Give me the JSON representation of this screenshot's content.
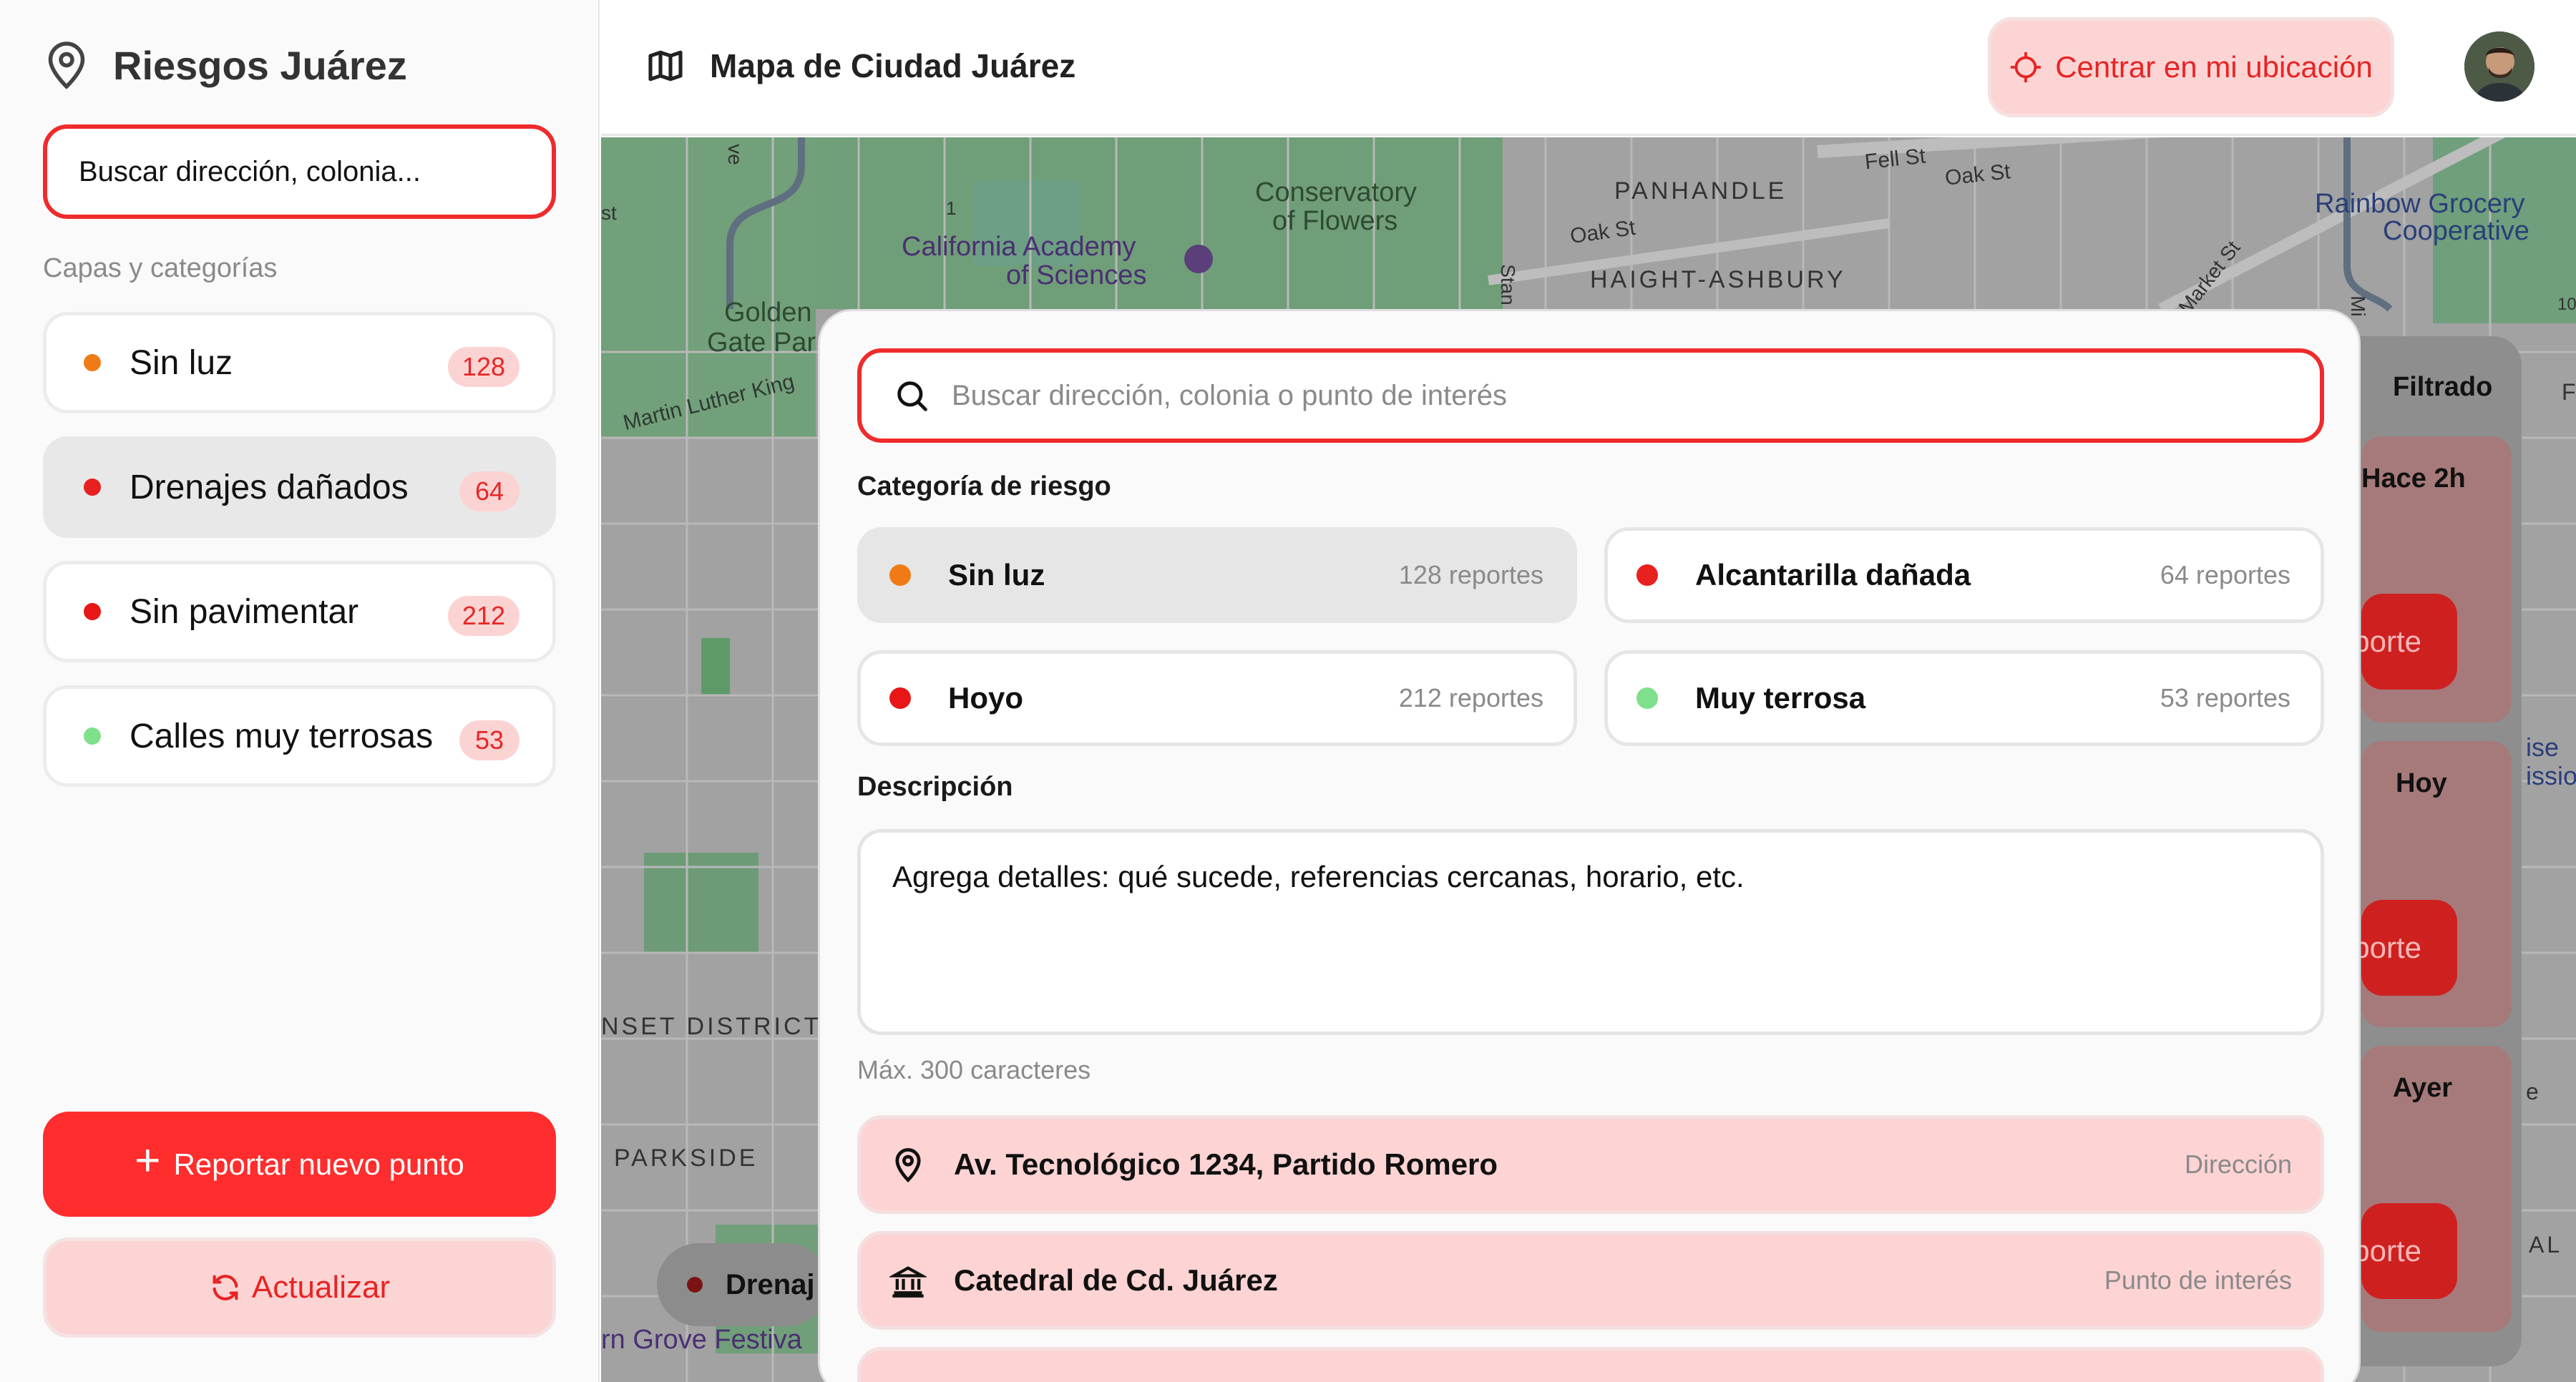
{
  "sidebar": {
    "title": "Riesgos Juárez",
    "search_value": "Buscar dirección, colonia...",
    "layers_label": "Capas y categorías",
    "layers": [
      {
        "label": "Sin luz",
        "count": "128",
        "color": "#f07b16"
      },
      {
        "label": "Drenajes dañados",
        "count": "64",
        "color": "#e82020"
      },
      {
        "label": "Sin pavimentar",
        "count": "212",
        "color": "#e81616"
      },
      {
        "label": "Calles muy terrosas",
        "count": "53",
        "color": "#7ee08b"
      }
    ],
    "report_button": "Reportar nuevo punto",
    "update_button": "Actualizar"
  },
  "header": {
    "title": "Mapa de Ciudad Juárez",
    "center_button": "Centrar en mi ubicación"
  },
  "map": {
    "labels": {
      "academy": "California Academy",
      "academy2": "of Sciences",
      "conservatory": "Conservatory",
      "conservatory2": "of Flowers",
      "golden": "Golden",
      "gate": "Gate Par",
      "mlk": "Martin Luther King",
      "panhandle": "PANHANDLE",
      "haight": "HAIGHT-ASHBURY",
      "fell": "Fell St",
      "oak1": "Oak St",
      "oak2": "Oak St",
      "market": "Market St",
      "stan": "Stan",
      "rainbow": "Rainbow Grocery",
      "coop": "Cooperative",
      "sunset": "NSET DISTRICT",
      "parkside": "PARKSIDE",
      "festival": "rn Grove Festiva",
      "route": "1",
      "st": "st",
      "ve": "ve",
      "mi": "Mi",
      "ten": "10",
      "ise": "ise",
      "issi": "issio",
      "al": "AL",
      "e": "e",
      "f": "F"
    },
    "drenaje_chip": "Drenaj",
    "right_panel": {
      "filter": "Filtrado",
      "items": [
        {
          "time": "Hace 2h",
          "button": "Reporte"
        },
        {
          "time": "Hoy",
          "button": "Reporte"
        },
        {
          "time": "Ayer",
          "button": "Reporte"
        }
      ]
    }
  },
  "modal": {
    "search_placeholder": "Buscar dirección, colonia o punto de interés",
    "category_label": "Categoría de riesgo",
    "categories": [
      {
        "name": "Sin luz",
        "reports": "128 reportes",
        "color": "#f07b16"
      },
      {
        "name": "Alcantarilla dañada",
        "reports": "64 reportes",
        "color": "#e82020"
      },
      {
        "name": "Hoyo",
        "reports": "212 reportes",
        "color": "#e81616"
      },
      {
        "name": "Muy terrosa",
        "reports": "53 reportes",
        "color": "#7ee08b"
      }
    ],
    "description_label": "Descripción",
    "description_placeholder": "Agrega detalles: qué sucede, referencias cercanas, horario, etc.",
    "max_hint": "Máx. 300 caracteres",
    "suggestions": [
      {
        "text": "Av. Tecnológico 1234, Partido Romero",
        "kind": "Dirección",
        "icon": "pin-icon"
      },
      {
        "text": "Catedral de Cd. Juárez",
        "kind": "Punto de interés",
        "icon": "landmark-icon"
      }
    ]
  }
}
